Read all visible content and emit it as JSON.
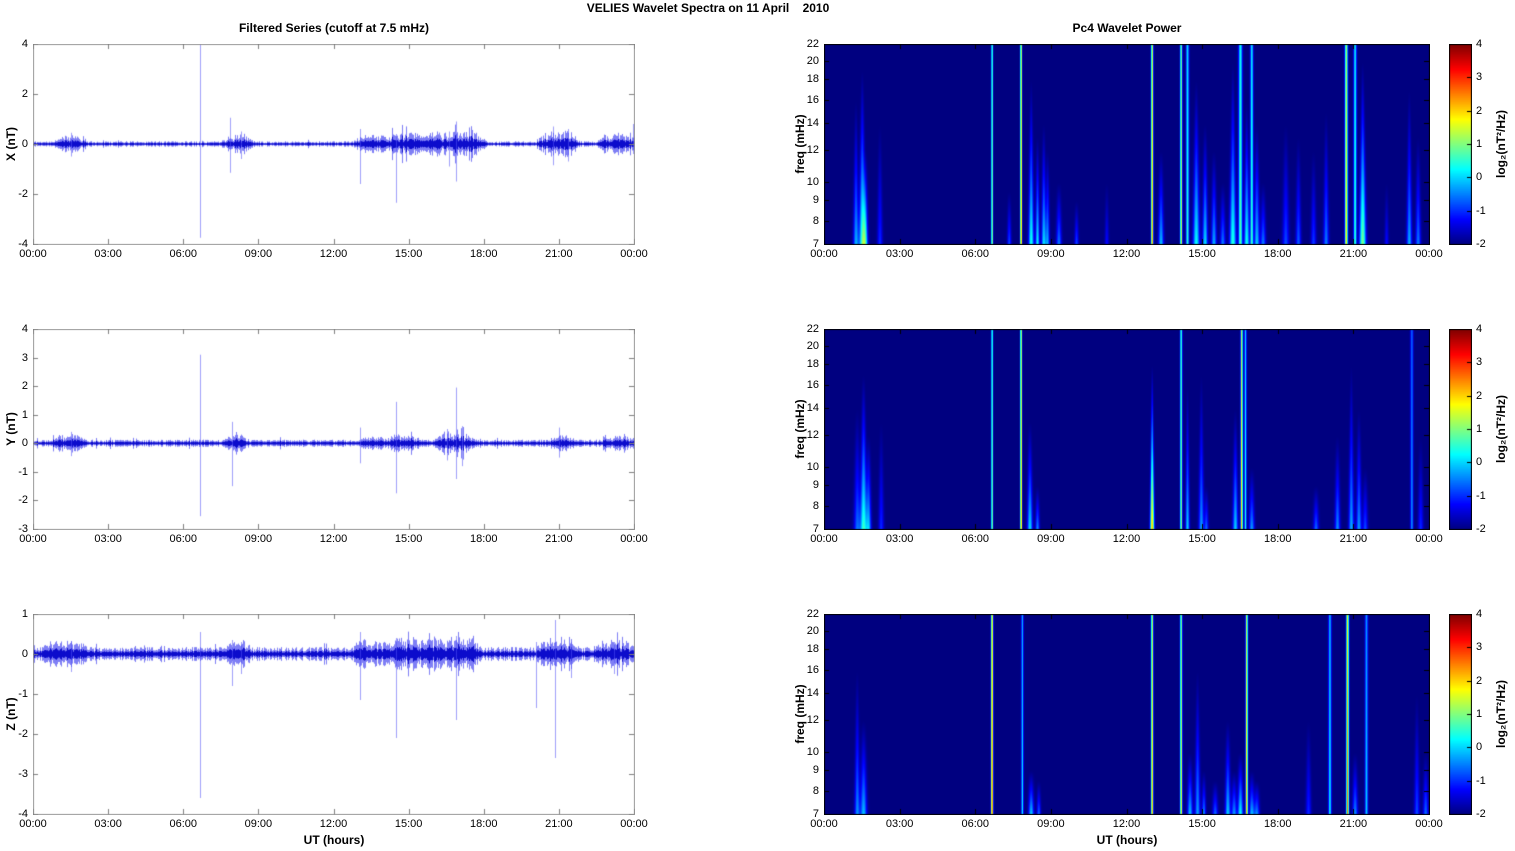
{
  "figure_title": "VELIES Wavelet Spectra on 11 April    2010",
  "titles": {
    "left": "Filtered Series (cutoff at 7.5 mHz)",
    "right": "Pc4 Wavelet Power"
  },
  "axis": {
    "xlabel": "UT (hours)",
    "x_ticks": [
      "00:00",
      "03:00",
      "06:00",
      "09:00",
      "12:00",
      "15:00",
      "18:00",
      "21:00",
      "00:00"
    ],
    "x_range_hours": [
      0,
      24
    ],
    "freq_label": "freq (mHz)",
    "freq_ticks": [
      7,
      8,
      9,
      10,
      12,
      14,
      16,
      18,
      20,
      22
    ],
    "freq_range_mhz": [
      7,
      22
    ],
    "colorbar_label": "log₂(nT²/Hz)",
    "colorbar_ticks": [
      4,
      3,
      2,
      1,
      0,
      -1,
      -2
    ],
    "clim": [
      -2,
      4
    ]
  },
  "colors": {
    "line_blue": "#0000eb",
    "spike_blue": "#5050f5",
    "ts_box": "#999999",
    "sp_box": "#000000",
    "colormap": "jet",
    "sp_background": "#000080"
  },
  "chart_data": [
    {
      "type": "line",
      "id": "timeseries-x",
      "title": "Filtered Series (cutoff at 7.5 mHz)",
      "ylabel": "X (nT)",
      "ylim": [
        -4,
        4
      ],
      "yticks": [
        4,
        2,
        0,
        -2,
        -4
      ],
      "grid": false,
      "noise_base": 0.075,
      "seed": 11,
      "bursts": [
        [
          0.9,
          2.0,
          0.18
        ],
        [
          7.6,
          8.7,
          0.22
        ],
        [
          12.9,
          14.2,
          0.22
        ],
        [
          14.2,
          15.6,
          0.28
        ],
        [
          15.6,
          18.0,
          0.3
        ],
        [
          20.2,
          21.7,
          0.33
        ],
        [
          22.6,
          24,
          0.22
        ]
      ],
      "spikes": [
        [
          1.5,
          0.45,
          -0.5
        ],
        [
          6.65,
          4.2,
          -3.75
        ],
        [
          7.85,
          1.05,
          -1.15
        ],
        [
          8.3,
          0.5,
          -0.6
        ],
        [
          13.05,
          0.6,
          -1.6
        ],
        [
          14.5,
          0.4,
          -2.35
        ],
        [
          16.6,
          0.5,
          -0.9
        ],
        [
          16.9,
          0.9,
          -1.5
        ],
        [
          20.75,
          0.7,
          -0.85
        ],
        [
          21.35,
          0.6,
          -0.7
        ],
        [
          23.97,
          0.8,
          -0.4
        ]
      ]
    },
    {
      "type": "line",
      "id": "timeseries-y",
      "ylabel": "Y (nT)",
      "ylim": [
        -3,
        4
      ],
      "yticks": [
        4,
        3,
        2,
        1,
        0,
        -1,
        -2,
        -3
      ],
      "grid": false,
      "noise_base": 0.085,
      "seed": 22,
      "bursts": [
        [
          0.8,
          2.0,
          0.16
        ],
        [
          7.7,
          8.5,
          0.18
        ],
        [
          13.0,
          14.0,
          0.1
        ],
        [
          14.2,
          15.4,
          0.16
        ],
        [
          16.1,
          17.6,
          0.22
        ],
        [
          20.6,
          21.6,
          0.14
        ],
        [
          22.8,
          24,
          0.12
        ]
      ],
      "spikes": [
        [
          1.5,
          0.4,
          -0.45
        ],
        [
          6.65,
          3.1,
          -2.55
        ],
        [
          7.95,
          0.75,
          -1.5
        ],
        [
          13.05,
          0.55,
          -0.7
        ],
        [
          14.5,
          1.45,
          -1.75
        ],
        [
          16.55,
          0.5,
          -0.6
        ],
        [
          16.9,
          1.95,
          -1.25
        ],
        [
          17.15,
          0.6,
          -0.8
        ],
        [
          21.0,
          0.55,
          -0.5
        ]
      ]
    },
    {
      "type": "line",
      "id": "timeseries-z",
      "ylabel": "Z (nT)",
      "ylim": [
        -4,
        1
      ],
      "yticks": [
        1,
        0,
        -1,
        -2,
        -3,
        -4
      ],
      "grid": false,
      "noise_base": 0.115,
      "seed": 33,
      "bursts": [
        [
          0.4,
          2.2,
          0.12
        ],
        [
          7.7,
          8.6,
          0.16
        ],
        [
          12.8,
          14.3,
          0.18
        ],
        [
          14.3,
          17.8,
          0.2
        ],
        [
          20.2,
          21.7,
          0.2
        ],
        [
          22.4,
          24,
          0.14
        ]
      ],
      "spikes": [
        [
          1.5,
          0.3,
          -0.45
        ],
        [
          6.65,
          0.55,
          -3.6
        ],
        [
          7.95,
          0.35,
          -0.8
        ],
        [
          8.3,
          0.3,
          -0.5
        ],
        [
          13.05,
          0.55,
          -1.15
        ],
        [
          14.5,
          0.4,
          -2.1
        ],
        [
          16.9,
          0.45,
          -1.65
        ],
        [
          20.1,
          0.3,
          -1.35
        ],
        [
          20.85,
          0.85,
          -2.6
        ],
        [
          21.5,
          0.3,
          -0.6
        ],
        [
          23.2,
          0.3,
          -0.5
        ]
      ]
    },
    {
      "type": "heatmap",
      "id": "wavelet-x",
      "title": "Pc4 Wavelet Power",
      "ylabel": "freq (mHz)",
      "flim": [
        7,
        22
      ],
      "clim": [
        -2,
        4
      ],
      "grid": false,
      "events": [
        [
          1.25,
          0.04,
          16,
          1.8,
          0
        ],
        [
          1.5,
          0.05,
          19,
          2.6,
          0
        ],
        [
          1.62,
          0.04,
          12,
          2.0,
          0
        ],
        [
          2.2,
          0.04,
          14,
          1.0,
          0
        ],
        [
          6.65,
          0.025,
          22,
          3.4,
          1
        ],
        [
          7.33,
          0.03,
          9.5,
          1.2,
          0
        ],
        [
          7.8,
          0.025,
          22,
          4.6,
          1
        ],
        [
          8.2,
          0.04,
          18,
          2.4,
          0
        ],
        [
          8.45,
          0.03,
          13,
          2.2,
          0
        ],
        [
          8.7,
          0.035,
          14,
          2.1,
          0
        ],
        [
          8.85,
          0.03,
          12,
          1.7,
          0
        ],
        [
          9.3,
          0.04,
          10,
          1.5,
          0
        ],
        [
          10.0,
          0.03,
          9,
          1.2,
          0
        ],
        [
          11.2,
          0.03,
          10,
          0.8,
          0
        ],
        [
          13.0,
          0.03,
          22,
          4.4,
          1
        ],
        [
          13.35,
          0.04,
          12,
          1.9,
          0
        ],
        [
          14.15,
          0.03,
          22,
          3.6,
          1
        ],
        [
          14.4,
          0.04,
          22,
          2.5,
          1
        ],
        [
          14.75,
          0.05,
          18,
          2.3,
          0
        ],
        [
          15.1,
          0.04,
          14,
          2.1,
          0
        ],
        [
          15.45,
          0.04,
          12,
          1.8,
          0
        ],
        [
          15.8,
          0.04,
          10,
          1.5,
          0
        ],
        [
          16.2,
          0.05,
          20,
          2.5,
          0
        ],
        [
          16.5,
          0.05,
          22,
          2.8,
          1
        ],
        [
          16.75,
          0.04,
          16,
          2.4,
          0
        ],
        [
          16.95,
          0.04,
          22,
          2.6,
          1
        ],
        [
          17.15,
          0.04,
          14,
          2.0,
          0
        ],
        [
          17.4,
          0.04,
          10,
          1.5,
          0
        ],
        [
          18.3,
          0.05,
          14,
          1.2,
          0
        ],
        [
          18.8,
          0.04,
          13,
          1.3,
          0
        ],
        [
          19.4,
          0.04,
          12,
          1.1,
          0
        ],
        [
          19.9,
          0.04,
          15,
          1.5,
          0
        ],
        [
          20.7,
          0.04,
          22,
          3.9,
          1
        ],
        [
          21.05,
          0.04,
          22,
          2.6,
          1
        ],
        [
          21.35,
          0.05,
          20,
          3.0,
          0
        ],
        [
          22.3,
          0.03,
          10,
          0.8,
          0
        ],
        [
          23.2,
          0.04,
          17,
          1.8,
          0
        ],
        [
          23.55,
          0.04,
          13,
          1.5,
          0
        ]
      ]
    },
    {
      "type": "heatmap",
      "id": "wavelet-y",
      "ylabel": "freq (mHz)",
      "flim": [
        7,
        22
      ],
      "clim": [
        -2,
        4
      ],
      "grid": false,
      "events": [
        [
          1.3,
          0.05,
          14,
          1.4,
          0
        ],
        [
          1.55,
          0.05,
          17,
          2.6,
          0
        ],
        [
          1.75,
          0.04,
          12,
          1.9,
          0
        ],
        [
          2.25,
          0.04,
          13,
          1.0,
          0
        ],
        [
          6.65,
          0.025,
          22,
          3.3,
          1
        ],
        [
          7.8,
          0.025,
          22,
          4.5,
          1
        ],
        [
          8.15,
          0.04,
          13,
          2.1,
          0
        ],
        [
          8.45,
          0.03,
          9,
          1.6,
          0
        ],
        [
          13.0,
          0.03,
          18,
          4.2,
          0
        ],
        [
          14.15,
          0.03,
          22,
          3.2,
          1
        ],
        [
          14.4,
          0.03,
          16,
          2.0,
          0
        ],
        [
          14.95,
          0.04,
          17,
          1.7,
          0
        ],
        [
          15.15,
          0.03,
          9,
          1.4,
          0
        ],
        [
          16.3,
          0.04,
          14,
          2.0,
          0
        ],
        [
          16.55,
          0.03,
          22,
          4.1,
          1
        ],
        [
          16.7,
          0.03,
          22,
          2.4,
          1
        ],
        [
          16.95,
          0.04,
          10,
          1.7,
          0
        ],
        [
          19.5,
          0.04,
          9,
          1.4,
          0
        ],
        [
          20.35,
          0.04,
          12,
          1.6,
          0
        ],
        [
          20.9,
          0.04,
          18,
          1.8,
          0
        ],
        [
          21.2,
          0.04,
          14,
          1.7,
          0
        ],
        [
          21.45,
          0.04,
          10,
          1.2,
          0
        ],
        [
          23.3,
          0.04,
          22,
          1.6,
          1
        ],
        [
          23.65,
          0.04,
          12,
          1.0,
          0
        ]
      ]
    },
    {
      "type": "heatmap",
      "id": "wavelet-z",
      "ylabel": "freq (mHz)",
      "flim": [
        7,
        22
      ],
      "clim": [
        -2,
        4
      ],
      "grid": false,
      "events": [
        [
          1.3,
          0.04,
          16,
          1.6,
          0
        ],
        [
          1.55,
          0.05,
          12,
          1.9,
          0
        ],
        [
          6.65,
          0.03,
          22,
          4.8,
          1
        ],
        [
          7.85,
          0.03,
          22,
          2.2,
          1
        ],
        [
          8.2,
          0.04,
          9,
          2.0,
          0
        ],
        [
          8.5,
          0.03,
          8.5,
          1.4,
          0
        ],
        [
          13.0,
          0.03,
          22,
          4.3,
          1
        ],
        [
          14.15,
          0.03,
          22,
          3.8,
          1
        ],
        [
          14.5,
          0.04,
          10,
          1.9,
          0
        ],
        [
          14.8,
          0.04,
          16,
          1.7,
          0
        ],
        [
          15.05,
          0.03,
          9,
          1.6,
          0
        ],
        [
          15.5,
          0.04,
          8.5,
          1.4,
          0
        ],
        [
          16.0,
          0.04,
          12,
          2.0,
          0
        ],
        [
          16.25,
          0.04,
          9,
          1.7,
          0
        ],
        [
          16.5,
          0.04,
          10,
          2.3,
          0
        ],
        [
          16.75,
          0.03,
          22,
          4.2,
          1
        ],
        [
          16.95,
          0.04,
          9,
          1.9,
          0
        ],
        [
          17.15,
          0.04,
          8.5,
          1.6,
          0
        ],
        [
          19.2,
          0.04,
          12,
          1.0,
          0
        ],
        [
          20.05,
          0.04,
          22,
          2.2,
          1
        ],
        [
          20.75,
          0.035,
          22,
          4.5,
          1
        ],
        [
          21.05,
          0.04,
          10,
          1.6,
          0
        ],
        [
          21.5,
          0.04,
          22,
          2.0,
          1
        ],
        [
          23.5,
          0.04,
          14,
          1.2,
          0
        ],
        [
          23.85,
          0.04,
          10,
          1.4,
          0
        ]
      ]
    }
  ]
}
